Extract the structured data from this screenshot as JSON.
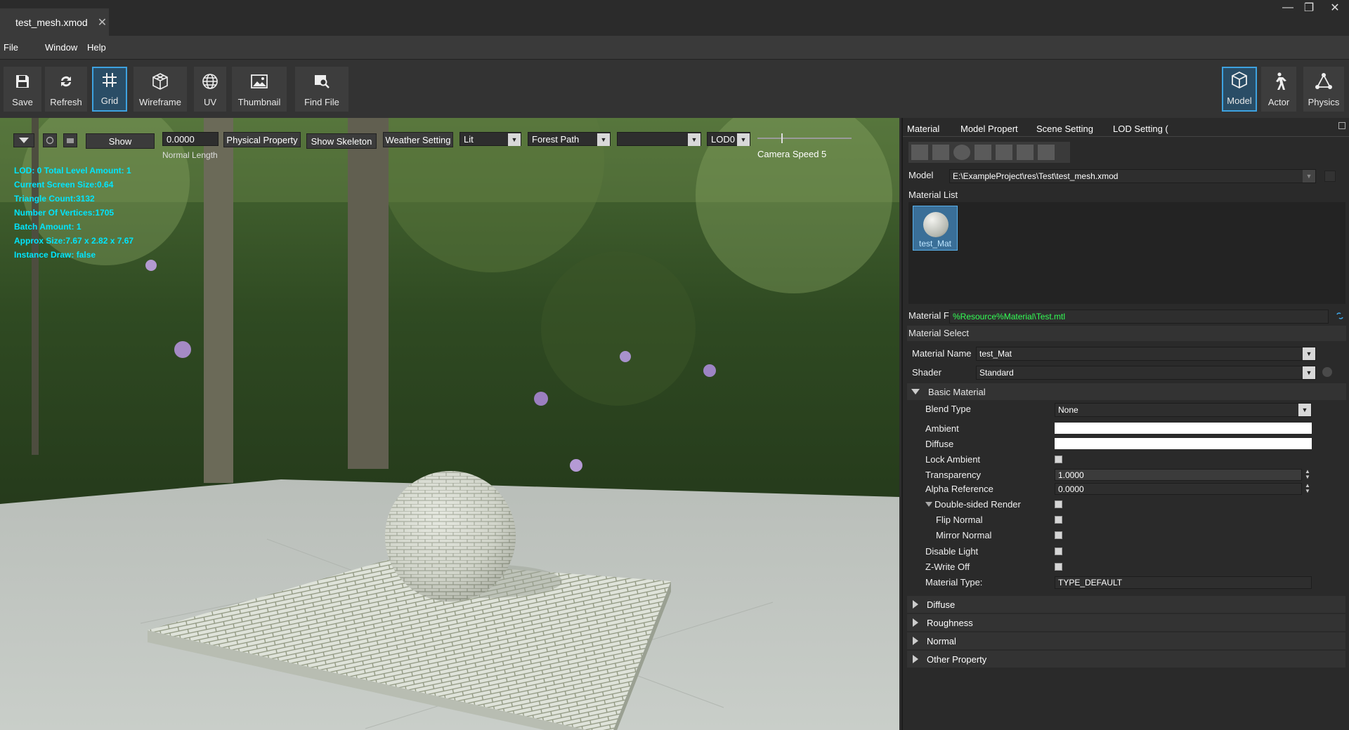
{
  "window": {
    "tab_title": "test_mesh.xmod",
    "tab_close": "✕",
    "minimize": "—",
    "restore": "❐",
    "close": "✕"
  },
  "menu": {
    "file": "File",
    "window": "Window",
    "help": "Help"
  },
  "toolbar": {
    "save": "Save",
    "refresh": "Refresh",
    "grid": "Grid",
    "wireframe": "Wireframe",
    "uv": "UV",
    "thumbnail": "Thumbnail",
    "find_file": "Find File",
    "model": "Model",
    "actor": "Actor",
    "physics": "Physics"
  },
  "viewport_bar": {
    "show": "Show",
    "normal_length_value": "0.0000",
    "normal_length_label": "Normal Length",
    "physical_property": "Physical Property",
    "show_skeleton": "Show Skeleton",
    "weather_setting": "Weather Setting",
    "lighting": "Lit",
    "environment": "Forest Path",
    "empty_select": "",
    "lod": "LOD0",
    "camera_speed": "Camera Speed 5"
  },
  "stats": [
    "LOD: 0 Total Level Amount: 1",
    "Current Screen Size:0.64",
    "Triangle Count:3132",
    "Number Of Vertices:1705",
    "Batch Amount: 1",
    "Approx Size:7.67 x 2.82 x 7.67",
    "Instance Draw: false"
  ],
  "panel": {
    "tabs": [
      "Material",
      "Model Propert",
      "Scene Setting",
      "LOD Setting ("
    ],
    "model_label": "Model",
    "model_path": "E:\\ExampleProject\\res\\Test\\test_mesh.xmod",
    "material_list_label": "Material List",
    "material_item": "test_Mat",
    "material_file_label": "Material F",
    "material_file": "%Resource%Material\\Test.mtl",
    "material_select": "Material Select",
    "material_name_label": "Material Name",
    "material_name": "test_Mat",
    "shader_label": "Shader",
    "shader": "Standard",
    "basic_material": "Basic Material",
    "blend_type_label": "Blend Type",
    "blend_type": "None",
    "ambient": "Ambient",
    "diffuse": "Diffuse",
    "lock_ambient": "Lock Ambient",
    "transparency_label": "Transparency",
    "transparency": "1.0000",
    "alpha_reference_label": "Alpha Reference",
    "alpha_reference": "0.0000",
    "double_sided": "Double-sided Render",
    "flip_normal": "Flip Normal",
    "mirror_normal": "Mirror Normal",
    "disable_light": "Disable Light",
    "z_write_off": "Z-Write Off",
    "material_type_label": "Material Type:",
    "material_type": "TYPE_DEFAULT",
    "sections": [
      "Diffuse",
      "Roughness",
      "Normal",
      "Other Property"
    ]
  },
  "colors": {
    "accent": "#3ea2e0",
    "stats_text": "#00e5ff",
    "path_text": "#33ff55"
  }
}
